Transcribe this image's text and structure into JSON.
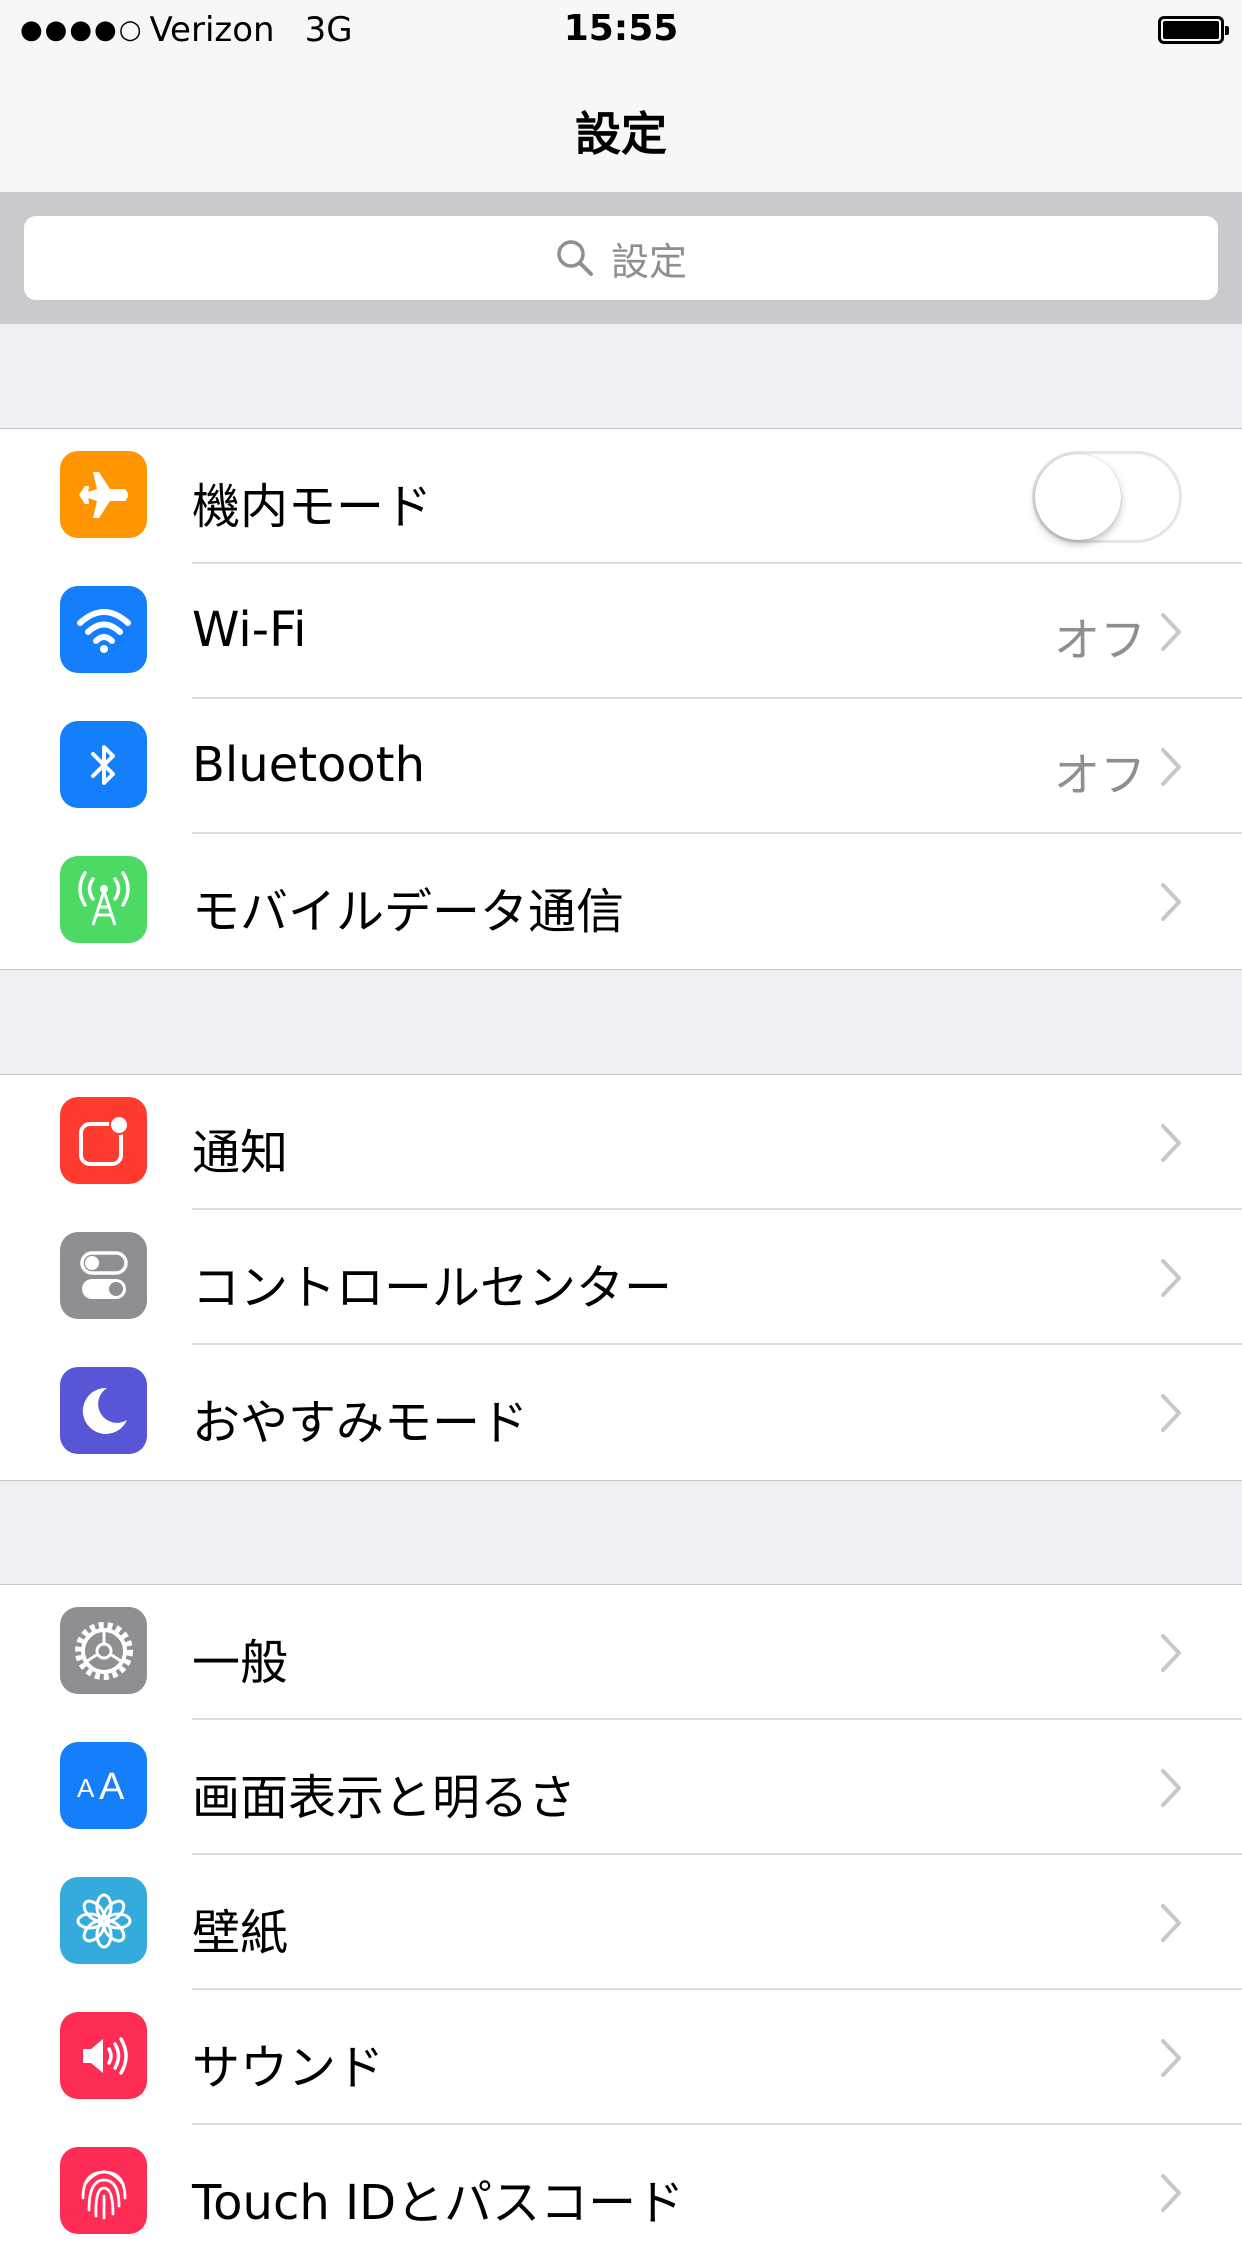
{
  "status_bar": {
    "signal": "●●●●○",
    "carrier": "Verizon",
    "network": "3G",
    "time": "15:55",
    "battery_icon": "battery-full-icon"
  },
  "nav": {
    "title": "設定"
  },
  "search": {
    "placeholder": "設定"
  },
  "groups": [
    {
      "rows": [
        {
          "label": "機内モード",
          "icon": "airplane-icon",
          "color": "#ff9500",
          "toggle": false
        },
        {
          "label": "Wi-Fi",
          "icon": "wifi-icon",
          "color": "#147efb",
          "value": "オフ"
        },
        {
          "label": "Bluetooth",
          "icon": "bluetooth-icon",
          "color": "#147efb",
          "value": "オフ"
        },
        {
          "label": "モバイルデータ通信",
          "icon": "cellular-icon",
          "color": "#4cd964"
        }
      ]
    },
    {
      "rows": [
        {
          "label": "通知",
          "icon": "notifications-icon",
          "color": "#ff3b30"
        },
        {
          "label": "コントロールセンター",
          "icon": "control-center-icon",
          "color": "#8e8e93"
        },
        {
          "label": "おやすみモード",
          "icon": "moon-icon",
          "color": "#5856d6"
        }
      ]
    },
    {
      "rows": [
        {
          "label": "一般",
          "icon": "gear-icon",
          "color": "#8e8e93"
        },
        {
          "label": "画面表示と明るさ",
          "icon": "display-brightness-icon",
          "color": "#147efb"
        },
        {
          "label": "壁紙",
          "icon": "wallpaper-flower-icon",
          "color": "#35aadc"
        },
        {
          "label": "サウンド",
          "icon": "speaker-icon",
          "color": "#ff2d55"
        },
        {
          "label": "Touch IDとパスコード",
          "icon": "fingerprint-icon",
          "color": "#ff2d55"
        }
      ]
    }
  ]
}
